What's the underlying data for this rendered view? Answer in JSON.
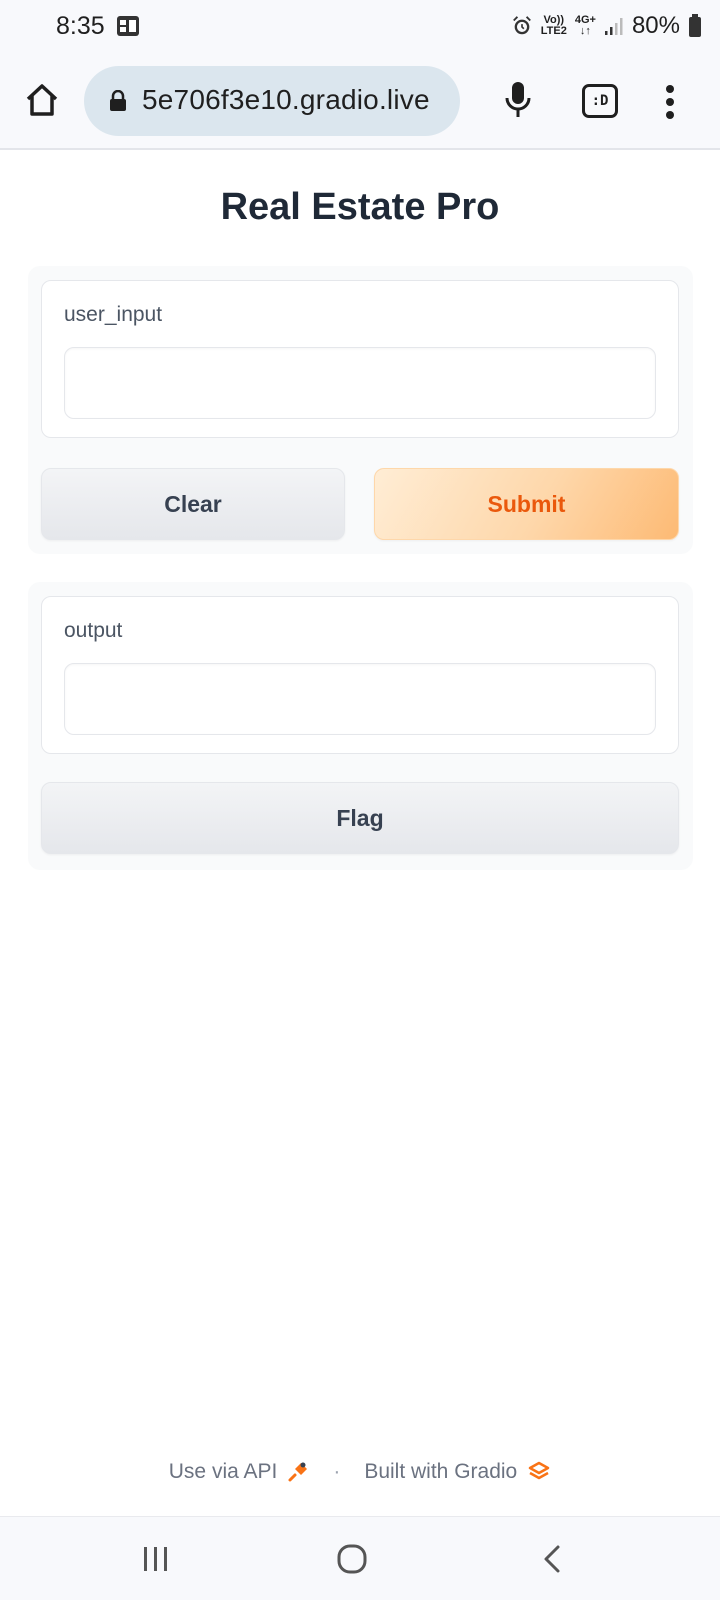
{
  "status_bar": {
    "time": "8:35",
    "net_top": "Vo))",
    "net_bottom": "LTE2",
    "net_type_top": "4G+",
    "net_type_bottom": "↓↑",
    "battery": "80%",
    "icons": [
      "notification-icon",
      "alarm-icon",
      "signal-icon",
      "battery-icon"
    ]
  },
  "browser": {
    "url": "5e706f3e10.gradio.live",
    "tab_icon_label": ":D",
    "icons": [
      "home-icon",
      "lock-icon",
      "mic-icon",
      "tab-switcher-icon",
      "more-vert-icon"
    ]
  },
  "app": {
    "title": "Real Estate Pro",
    "input_label": "user_input",
    "input_value": "",
    "clear_label": "Clear",
    "submit_label": "Submit",
    "output_label": "output",
    "output_value": "",
    "flag_label": "Flag"
  },
  "footer": {
    "api_link": "Use via API",
    "separator": "·",
    "built_with": "Built with Gradio"
  },
  "nav_bar": {
    "icons": [
      "recent-apps-icon",
      "home-circle-icon",
      "back-icon"
    ]
  },
  "colors": {
    "accent": "#ea580c",
    "accent_light": "#fed7aa",
    "gradio_orange": "#f97316"
  }
}
